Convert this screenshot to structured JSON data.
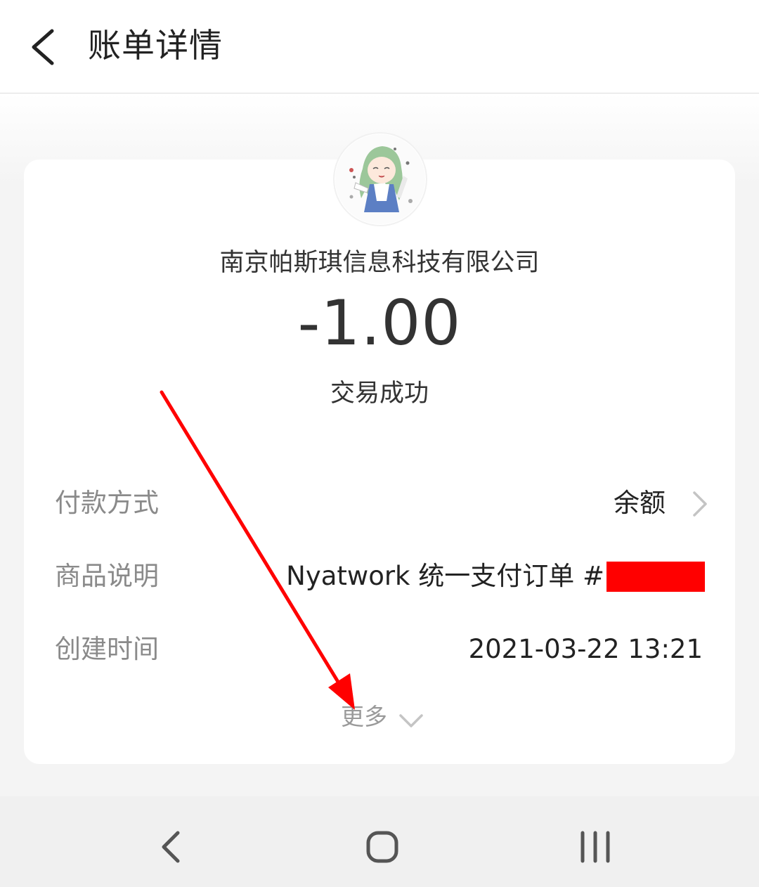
{
  "header": {
    "title": "账单详情",
    "back_icon": "chevron-left-icon"
  },
  "bill": {
    "merchant": "南京帕斯琪信息科技有限公司",
    "amount": "-1.00",
    "status": "交易成功",
    "rows": [
      {
        "label": "付款方式",
        "value": "余额"
      },
      {
        "label": "商品说明",
        "value": "Nyatwork 统一支付订单 #"
      },
      {
        "label": "创建时间",
        "value": "2021-03-22 13:21"
      }
    ],
    "more_label": "更多"
  },
  "annotation": {
    "arrow_color": "#ff0000",
    "redaction_color": "#ff0000"
  },
  "navbar": {
    "icons": [
      "nav-back-icon",
      "nav-home-icon",
      "nav-recents-icon"
    ]
  }
}
